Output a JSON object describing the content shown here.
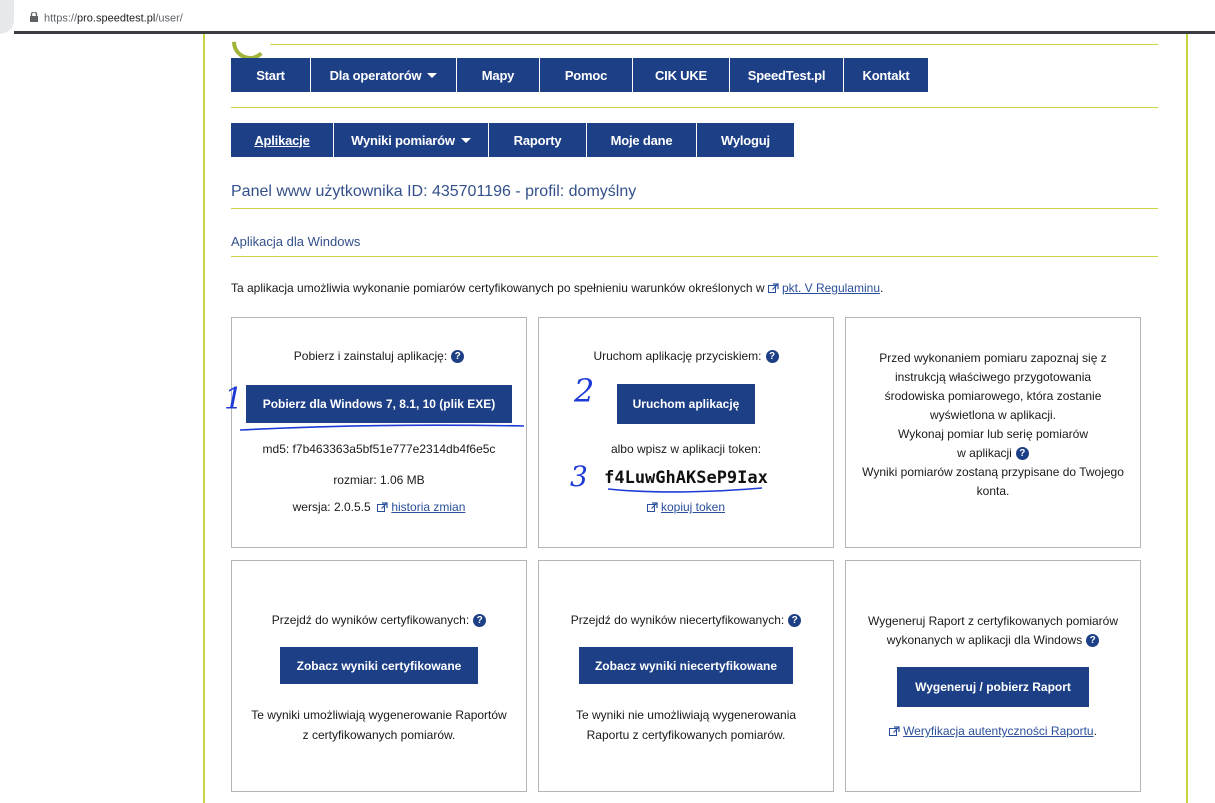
{
  "browser": {
    "url_prefix": "https://",
    "url_host": "pro.speedtest.pl",
    "url_path": "/user/"
  },
  "nav_main": [
    {
      "label": "Start",
      "caret": false
    },
    {
      "label": "Dla operatorów",
      "caret": true
    },
    {
      "label": "Mapy",
      "caret": false
    },
    {
      "label": "Pomoc",
      "caret": false
    },
    {
      "label": "CIK UKE",
      "caret": false
    },
    {
      "label": "SpeedTest.pl",
      "caret": false
    },
    {
      "label": "Kontakt",
      "caret": false
    }
  ],
  "nav_user": [
    {
      "label": "Aplikacje",
      "caret": false,
      "active": true
    },
    {
      "label": "Wyniki pomiarów",
      "caret": true
    },
    {
      "label": "Raporty",
      "caret": false
    },
    {
      "label": "Moje dane",
      "caret": false
    },
    {
      "label": "Wyloguj",
      "caret": false
    }
  ],
  "panel_title": "Panel www użytkownika ID: 435701196 - profil: domyślny",
  "section_title": "Aplikacja dla Windows",
  "intro": {
    "text": "Ta aplikacja umożliwia wykonanie pomiarów certyfikowanych po spełnieniu warunków określonych w",
    "link": "pkt. V Regulaminu",
    "suffix": "."
  },
  "card_download": {
    "heading": "Pobierz i zainstaluj aplikację:",
    "button": "Pobierz dla Windows 7, 8.1, 10 (plik EXE)",
    "md5": "md5: f7b463363a5bf51e777e2314db4f6e5c",
    "size": "rozmiar: 1.06 MB",
    "version": "wersja: 2.0.5.5",
    "history_link": "historia zmian"
  },
  "card_run": {
    "heading": "Uruchom aplikację przyciskiem:",
    "button": "Uruchom aplikację",
    "or_text": "albo wpisz w aplikacji token:",
    "token": "f4LuwGhAKSeP9Iax",
    "copy_link": "kopiuj token"
  },
  "card_info": {
    "lines": [
      "Przed wykonaniem pomiaru zapoznaj się z",
      "instrukcją właściwego przygotowania",
      "środowiska pomiarowego, która zostanie",
      "wyświetlona w aplikacji.",
      "Wykonaj pomiar lub serię pomiarów",
      "w aplikacji",
      "Wyniki pomiarów zostaną przypisane do Twojego",
      "konta."
    ]
  },
  "card_cert": {
    "heading": "Przejdź do wyników certyfikowanych:",
    "button": "Zobacz wyniki certyfikowane",
    "note_line1": "Te wyniki umożliwiają wygenerowanie Raportów",
    "note_line2": "z certyfikowanych pomiarów."
  },
  "card_noncert": {
    "heading": "Przejdź do wyników niecertyfikowanych:",
    "button": "Zobacz wyniki niecertyfikowane",
    "note_line1": "Te wyniki nie umożliwiają wygenerowania",
    "note_line2": "Raportu z certyfikowanych pomiarów."
  },
  "card_report": {
    "heading_line1": "Wygeneruj Raport z certyfikowanych pomiarów",
    "heading_line2": "wykonanych w aplikacji dla Windows",
    "button": "Wygeneruj / pobierz Raport",
    "verify_link": "Weryfikacja autentyczności Raportu",
    "verify_suffix": "."
  },
  "annotations": {
    "n1": "1",
    "n2": "2",
    "n3": "3"
  },
  "colors": {
    "nav_bg": "#1d3f86",
    "accent_line": "#c8d441",
    "title": "#33508a",
    "annotation": "#1e3ad6"
  }
}
